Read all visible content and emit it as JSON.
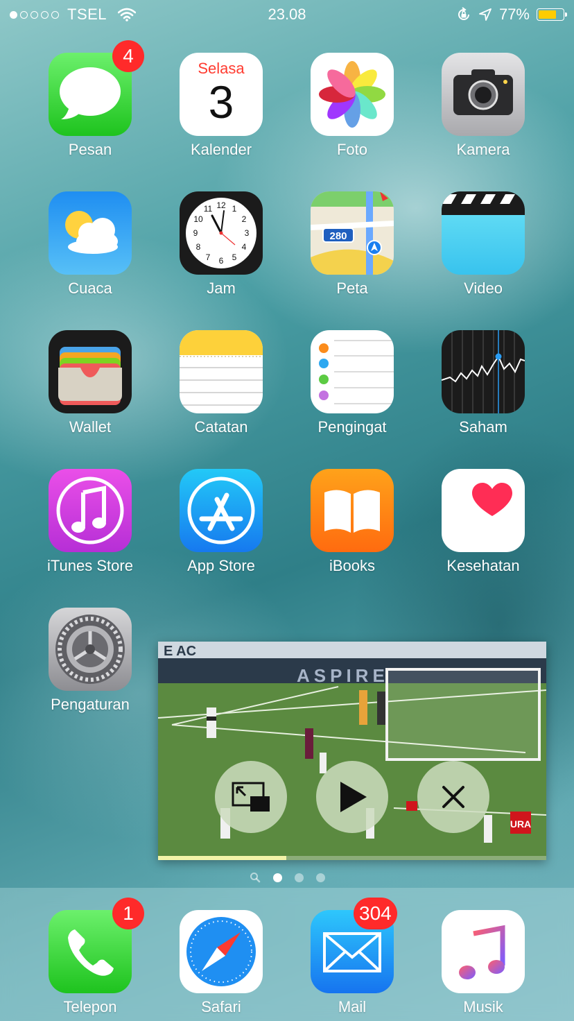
{
  "status_bar": {
    "carrier": "TSEL",
    "time": "23.08",
    "battery": "77%",
    "battery_level": 0.77,
    "battery_color": "#ffcc00",
    "signal_bars": 1
  },
  "apps": [
    {
      "name": "Pesan",
      "badge": "4"
    },
    {
      "name": "Kalender",
      "weekday": "Selasa",
      "day": "3"
    },
    {
      "name": "Foto"
    },
    {
      "name": "Kamera"
    },
    {
      "name": "Cuaca"
    },
    {
      "name": "Jam"
    },
    {
      "name": "Peta",
      "route": "280"
    },
    {
      "name": "Video"
    },
    {
      "name": "Wallet"
    },
    {
      "name": "Catatan"
    },
    {
      "name": "Pengingat"
    },
    {
      "name": "Saham"
    },
    {
      "name": "iTunes Store"
    },
    {
      "name": "App Store"
    },
    {
      "name": "iBooks"
    },
    {
      "name": "Kesehatan"
    },
    {
      "name": "Pengaturan"
    }
  ],
  "dock": [
    {
      "name": "Telepon",
      "badge": "1"
    },
    {
      "name": "Safari"
    },
    {
      "name": "Mail",
      "badge": "304"
    },
    {
      "name": "Musik"
    }
  ],
  "page_indicator": {
    "pages": 3,
    "current": 1
  },
  "pip": {
    "progress": 0.33,
    "buttons": [
      "exit-pip-icon",
      "play-icon",
      "close-icon"
    ],
    "ad_text": "ASPIRE",
    "banner_text": "E AC",
    "corner_text": "URA"
  }
}
